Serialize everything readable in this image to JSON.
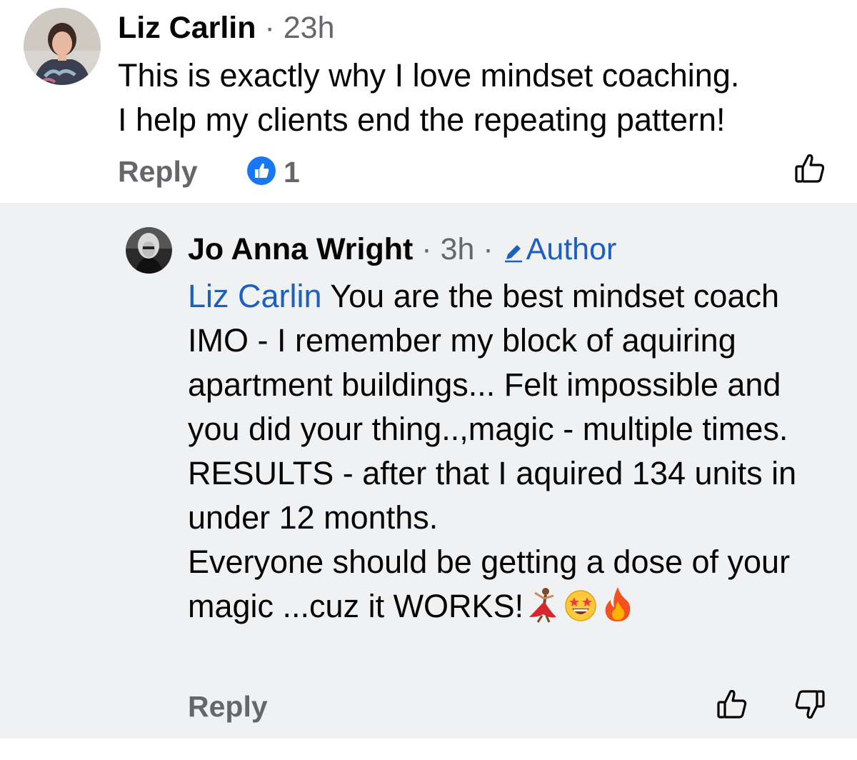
{
  "comment": {
    "author": "Liz Carlin",
    "separator": "·",
    "time": "23h",
    "text": "This is exactly why I love mindset coaching.\nI help my clients end the repeating pattern!",
    "reply_label": "Reply",
    "reaction_count": "1",
    "reaction_icon": "like-reaction-icon",
    "accent": "#1877f2"
  },
  "reply": {
    "author": "Jo Anna Wright",
    "separator1": "·",
    "time": "3h",
    "separator2": "·",
    "badge": "Author",
    "badge_icon": "pencil-icon",
    "mention": "Liz Carlin",
    "text": " You are the best mindset coach IMO - I remember my block of aquiring apartment buildings... Felt impossible and you did your thing..,magic - multiple times. RESULTS - after that I aquired 134 units in under 12 months.\nEveryone should be getting a dose of your magic ...cuz it WORKS!",
    "emojis": [
      "dancer-emoji",
      "star-struck-emoji",
      "fire-emoji"
    ],
    "reply_label": "Reply",
    "mention_color": "#1c5fbe",
    "background": "#f0f1f3"
  }
}
